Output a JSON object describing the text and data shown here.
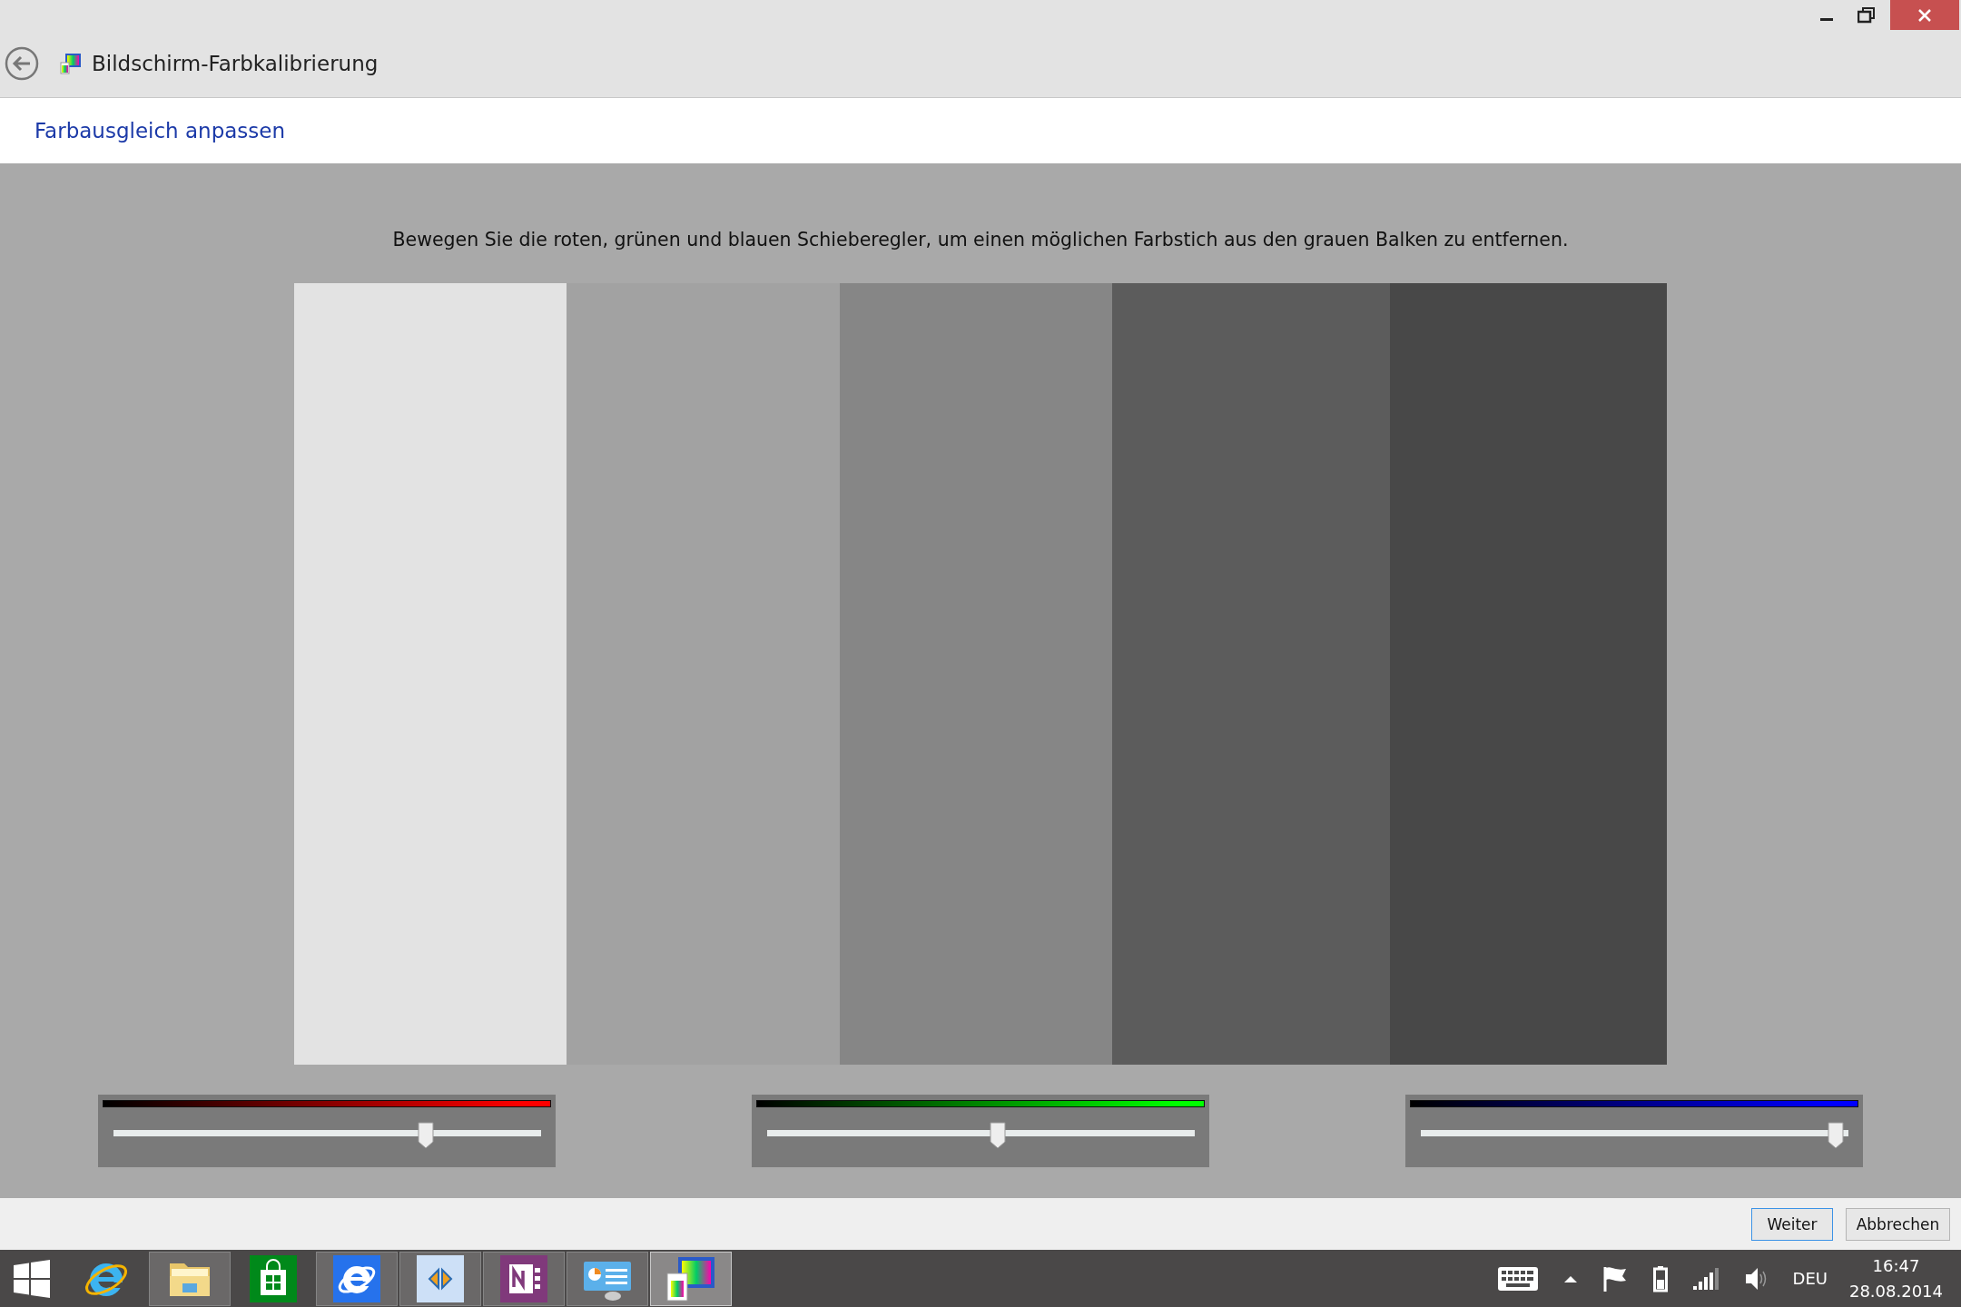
{
  "window": {
    "title": "Bildschirm-Farbkalibrierung"
  },
  "page": {
    "heading": "Farbausgleich anpassen",
    "instruction": "Bewegen Sie die roten, grünen und blauen Schieberegler, um einen möglichen Farbstich aus den grauen Balken zu entfernen."
  },
  "sliders": [
    {
      "color": "#ff0000",
      "level": 0.73
    },
    {
      "color": "#00ff00",
      "level": 0.54
    },
    {
      "color": "#0000ff",
      "level": 0.97
    }
  ],
  "buttons": [
    {
      "label": "Weiter",
      "focused": true
    },
    {
      "label": "Abbrechen",
      "focused": false
    }
  ],
  "taskbar": {
    "apps": [
      {
        "kind": "ie",
        "running": false,
        "active": false
      },
      {
        "kind": "folder",
        "running": true,
        "active": false
      },
      {
        "kind": "store",
        "running": false,
        "active": false
      },
      {
        "kind": "ie-tile",
        "running": true,
        "active": false
      },
      {
        "kind": "app",
        "running": true,
        "active": false
      },
      {
        "kind": "onenote",
        "running": true,
        "active": false
      },
      {
        "kind": "panel",
        "running": true,
        "active": false
      },
      {
        "kind": "calibration",
        "running": true,
        "active": true
      }
    ],
    "language": "DEU",
    "time": "16:47",
    "date": "28.08.2014"
  }
}
